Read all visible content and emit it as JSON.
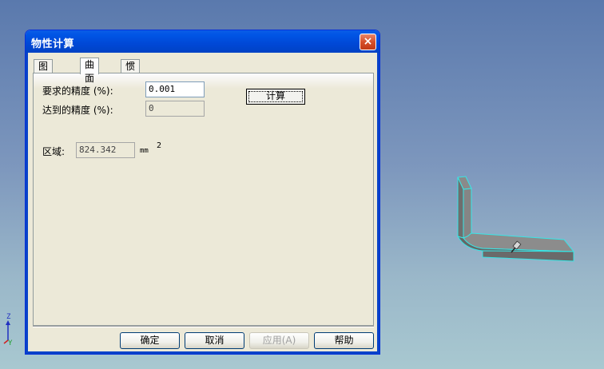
{
  "dialog": {
    "title": "物性计算",
    "close_label": "×",
    "tabs": [
      {
        "label": "图素实体"
      },
      {
        "label": "曲面"
      },
      {
        "label": "惯性矩"
      }
    ],
    "fields": {
      "required_precision_label": "要求的精度 (%):",
      "required_precision_value": "0.001",
      "achieved_precision_label": "达到的精度 (%):",
      "achieved_precision_value": "0",
      "area_label": "区域:",
      "area_value": "824.342",
      "area_unit": "mm",
      "area_exponent": "2"
    },
    "calc_button": "计算",
    "buttons": {
      "ok": "确定",
      "cancel": "取消",
      "apply": "应用(A)",
      "help": "帮助"
    }
  },
  "triad": {
    "z_label": "Z",
    "y_label": "Y"
  },
  "colors": {
    "titlebar": "#0055e5",
    "dialog_bg": "#ece9d8",
    "model_edge": "#38e6e6",
    "model_face": "#7a7a7a"
  }
}
